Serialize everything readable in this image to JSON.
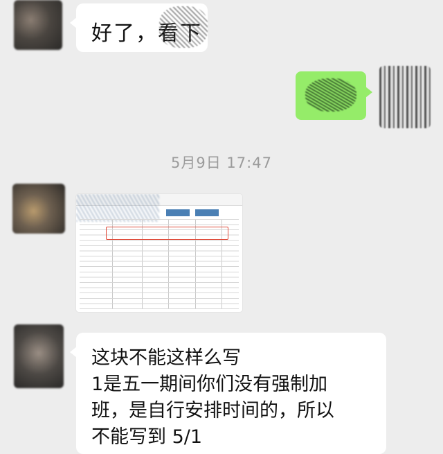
{
  "messages": [
    {
      "side": "left",
      "type": "text",
      "text": "好了，看下"
    },
    {
      "side": "right",
      "type": "text",
      "text": ""
    },
    {
      "side": "center",
      "type": "timestamp",
      "text": "5月9日 17:47"
    },
    {
      "side": "left",
      "type": "image",
      "text": ""
    },
    {
      "side": "left",
      "type": "text",
      "lines": [
        "这块不能这样么写",
        "1是五一期间你们没有强制加",
        "班，是自行安排时间的，所以",
        "不能写到 5/1"
      ]
    }
  ],
  "colors": {
    "background": "#ededed",
    "incoming_bubble": "#ffffff",
    "outgoing_bubble": "#95ec69",
    "timestamp": "#9b9b9b",
    "highlight_box": "#e04a3a"
  },
  "icons": [
    "avatar",
    "avatar",
    "avatar",
    "avatar"
  ]
}
